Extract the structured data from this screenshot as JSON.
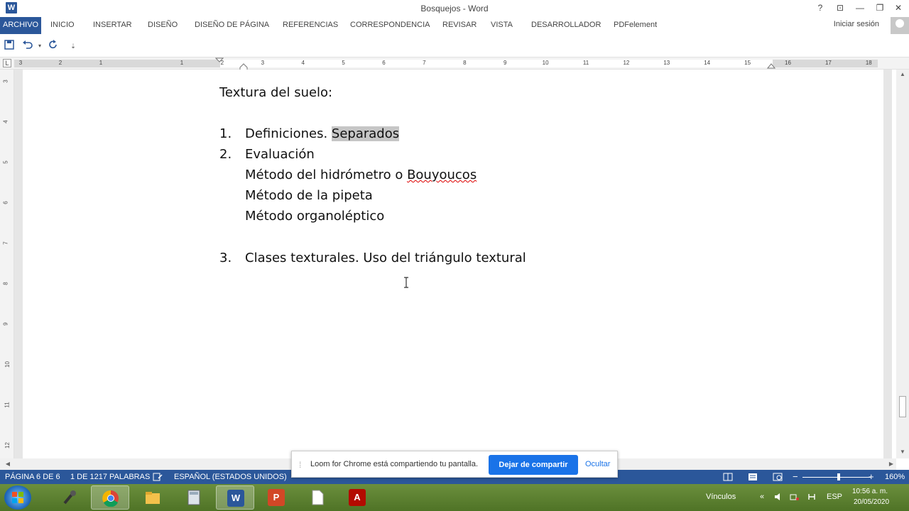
{
  "window": {
    "app_logo": "W",
    "title": "Bosquejos - Word",
    "help": "?",
    "restore_ribbon": "⊡",
    "minimize": "—",
    "maximize": "❐",
    "close": "✕"
  },
  "ribbon": {
    "tabs": [
      "ARCHIVO",
      "INICIO",
      "INSERTAR",
      "DISEÑO",
      "DISEÑO DE PÁGINA",
      "REFERENCIAS",
      "CORRESPONDENCIA",
      "REVISAR",
      "VISTA",
      "DESARROLLADOR",
      "PDFelement"
    ],
    "active_tab": "ARCHIVO",
    "signin": "Iniciar sesión"
  },
  "qat": {
    "save_icon": "save-icon",
    "undo_icon": "undo-icon",
    "redo_icon": "redo-icon",
    "customize": "⇣"
  },
  "ruler": {
    "corner": "L",
    "numbers": [
      "3",
      "2",
      "1",
      "1",
      "2",
      "3",
      "4",
      "5",
      "6",
      "7",
      "8",
      "9",
      "10",
      "11",
      "12",
      "13",
      "14",
      "15",
      "16",
      "17",
      "18"
    ],
    "vnumbers": [
      "3",
      "4",
      "5",
      "6",
      "7",
      "8",
      "9",
      "10",
      "11",
      "12"
    ]
  },
  "document": {
    "heading": "Textura del suelo:",
    "items": [
      {
        "num": "1.",
        "text": "Definiciones. ",
        "highlighted": "Separados"
      },
      {
        "num": "2.",
        "text": "Evaluación"
      },
      {
        "sub": "Método del hidrómetro o ",
        "misspelled": "Bouyoucos"
      },
      {
        "sub": "Método de la pipeta"
      },
      {
        "sub": "Método organoléptico"
      },
      {
        "num": "3.",
        "text": "Clases texturales. Uso del triángulo textural"
      }
    ]
  },
  "status_bar": {
    "page": "PÁGINA 6 DE 6",
    "words": "1 DE 1217 PALABRAS",
    "language": "ESPAÑOL (ESTADOS UNIDOS)",
    "zoom_minus": "−",
    "zoom_plus": "+",
    "zoom": "160%",
    "zoom_level_percent": 160
  },
  "loom": {
    "message": "Loom for Chrome está compartiendo tu pantalla.",
    "stop": "Dejar de compartir",
    "hide": "Ocultar"
  },
  "taskbar": {
    "apps": [
      "microphone",
      "chrome",
      "explorer",
      "calculator",
      "word",
      "powerpoint",
      "notepad",
      "acrobat"
    ],
    "word_label": "W",
    "ppt_label": "P",
    "acrobat_label": "A",
    "links": "Vínculos",
    "lang": "ESP",
    "time": "10:56 a. m.",
    "date": "20/05/2020"
  },
  "colors": {
    "word_blue": "#2b579a",
    "taskbar_green": "#5a7f2f",
    "loom_blue": "#1a73e8"
  }
}
